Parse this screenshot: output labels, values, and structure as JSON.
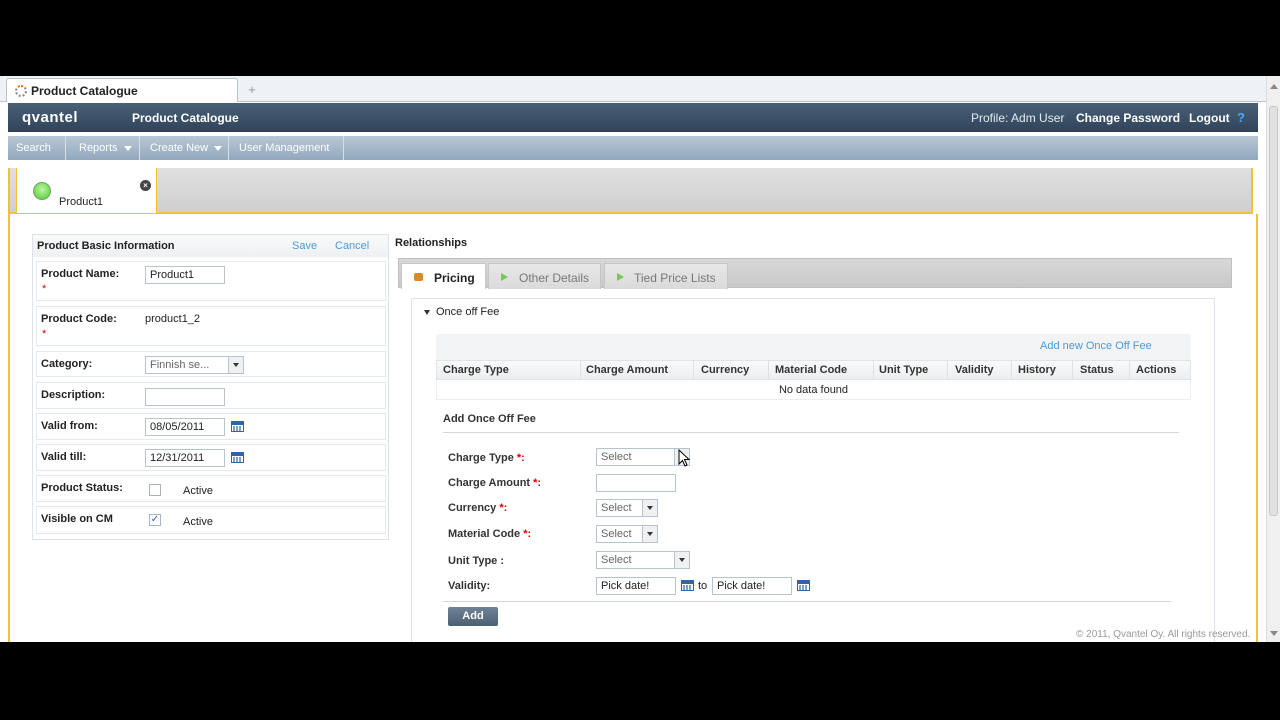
{
  "browser": {
    "tab_title": "Product Catalogue",
    "new_tab_symbol": "+"
  },
  "header": {
    "logo": "qvantel",
    "app_title": "Product Catalogue",
    "profile": "Profile: Adm User",
    "change_password": "Change Password",
    "logout": "Logout",
    "help": "?"
  },
  "menu": [
    {
      "label": "Search",
      "dropdown": false
    },
    {
      "label": "Reports",
      "dropdown": true
    },
    {
      "label": "Create New",
      "dropdown": true
    },
    {
      "label": "User Management",
      "dropdown": true
    }
  ],
  "product_tab": {
    "label": "Product1",
    "close": "×",
    "status_color": "#4cc735"
  },
  "basic_info": {
    "title": "Product Basic Information",
    "save": "Save",
    "cancel": "Cancel",
    "product_name_label": "Product Name:",
    "product_name_value": "Product1",
    "required_mark": "*",
    "product_code_label": "Product Code:",
    "product_code_value": "product1_2",
    "category_label": "Category:",
    "category_value": "Finnish se...",
    "description_label": "Description:",
    "description_value": "",
    "valid_from_label": "Valid from:",
    "valid_from_value": "08/05/2011",
    "valid_till_label": "Valid till:",
    "valid_till_value": "12/31/2011",
    "status_label": "Product Status:",
    "status_active": "Active",
    "status_checked": false,
    "visible_label": "Visible on CM",
    "visible_active": "Active",
    "visible_checked": true
  },
  "relationships": {
    "title": "Relationships",
    "tabs": [
      {
        "label": "Pricing",
        "active": true
      },
      {
        "label": "Other Details",
        "active": false
      },
      {
        "label": "Tied Price Lists",
        "active": false
      }
    ]
  },
  "once_off_fee": {
    "section_title": "Once off Fee",
    "add_new_link": "Add new Once Off Fee",
    "columns": [
      "Charge Type",
      "Charge Amount",
      "Currency",
      "Material Code",
      "Unit Type",
      "Validity",
      "History",
      "Status",
      "Actions"
    ],
    "empty_message": "No data found"
  },
  "add_form": {
    "title": "Add Once Off Fee",
    "charge_type_label": "Charge Type",
    "charge_type_value": "Select",
    "charge_amount_label": "Charge Amount",
    "charge_amount_value": "",
    "currency_label": "Currency",
    "currency_value": "Select",
    "material_code_label": "Material Code",
    "material_code_value": "Select",
    "unit_type_label": "Unit Type :",
    "unit_type_value": "Select",
    "validity_label": "Validity:",
    "validity_from": "Pick date!",
    "validity_to_word": "to",
    "validity_to": "Pick date!",
    "req_suffix": "*:",
    "add_button": "Add"
  },
  "footer": "© 2011, Qvantel Oy. All rights reserved.",
  "colors": {
    "accent": "#f1c232",
    "header": "#2f4459",
    "link": "#4b9ad8"
  }
}
